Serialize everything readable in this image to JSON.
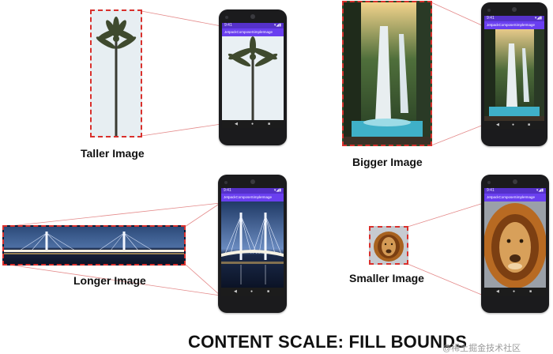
{
  "phone": {
    "app_title": "JetpackComposeSimpleImage",
    "status_time": "9:41",
    "status_icons": "▾◢▮",
    "nav_back": "◀",
    "nav_home": "●",
    "nav_recent": "■"
  },
  "panels": {
    "taller": {
      "label": "Taller Image"
    },
    "bigger": {
      "label": "Bigger Image"
    },
    "longer": {
      "label": "Longer Image"
    },
    "smaller": {
      "label": "Smaller Image"
    }
  },
  "footer": {
    "title": "CONTENT SCALE: FILL BOUNDS"
  },
  "watermark": {
    "text": "@稀土掘金技术社区"
  },
  "colors": {
    "dashed_border": "#d9302c",
    "connector": "#e48a8a",
    "status_bar": "#5531c9",
    "app_bar": "#6a3ff0",
    "phone_body": "#1b1b1d"
  }
}
